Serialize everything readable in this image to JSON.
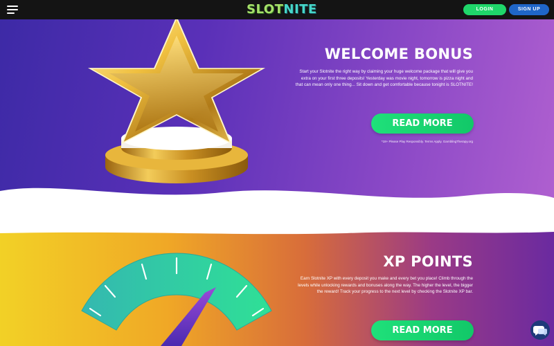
{
  "header": {
    "logo_part1": "SLOT",
    "logo_part2": "NITE",
    "login_label": "LOGIN",
    "signup_label": "SIGN UP"
  },
  "welcome": {
    "title": "WELCOME BONUS",
    "lines": [
      "Start your Slotnite the right way by claiming your huge welcome package that will give you",
      "extra on your first three deposits! Yesterday was movie night, tomorrow is pizza night and",
      "that can mean only one thing... Sit down and get comfortable because tonight is SLOTNITE!"
    ],
    "cta_label": "READ MORE",
    "disclaimer": "*18+ Please Play Responsibly. Terms Apply. GamblingTherapy.org"
  },
  "xp": {
    "title": "XP POINTS",
    "lines": [
      "Earn Slotnite XP with every deposit you make and every bet you place! Climb through the",
      "levels while unlocking rewards and bonuses along the way. The higher the level, the bigger",
      "the reward! Track your progress to the next level by checking the Slotnite XP bar."
    ],
    "cta_label": "READ MORE"
  },
  "colors": {
    "login": "#1fd66a",
    "signup": "#1f66c8",
    "cta": "#1fe07a",
    "hero1_start": "#3d2aa6",
    "hero1_end": "#b060d0",
    "hero2_start": "#f2d126",
    "hero2_end": "#6a2aa0",
    "gauge": "#2fd6a0"
  },
  "icons": {
    "menu": "hamburger-icon",
    "chat": "chat-icon",
    "star": "star-trophy-icon",
    "gauge": "gauge-icon"
  }
}
